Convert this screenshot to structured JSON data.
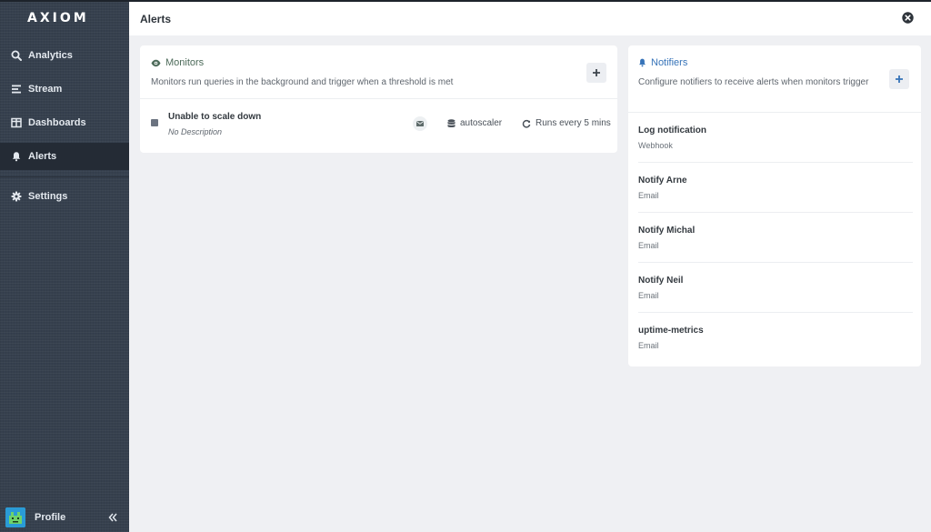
{
  "app": {
    "logo": "AXIOM"
  },
  "sidebar": {
    "items": [
      {
        "label": "Analytics",
        "icon": "search-icon"
      },
      {
        "label": "Stream",
        "icon": "stream-icon"
      },
      {
        "label": "Dashboards",
        "icon": "dashboard-icon"
      },
      {
        "label": "Alerts",
        "icon": "bell-icon",
        "active": true
      },
      {
        "label": "Settings",
        "icon": "gear-icon"
      }
    ],
    "profile_label": "Profile"
  },
  "header": {
    "title": "Alerts"
  },
  "monitors": {
    "title": "Monitors",
    "description": "Monitors run queries in the background and trigger when a threshold is met",
    "items": [
      {
        "name": "Unable to scale down",
        "description": "No Description",
        "dataset": "autoscaler",
        "schedule": "Runs every 5 mins"
      }
    ]
  },
  "notifiers": {
    "title": "Notifiers",
    "description": "Configure notifiers to receive alerts when monitors trigger",
    "items": [
      {
        "name": "Log notification",
        "type": "Webhook"
      },
      {
        "name": "Notify Arne",
        "type": "Email"
      },
      {
        "name": "Notify Michal",
        "type": "Email"
      },
      {
        "name": "Notify Neil",
        "type": "Email"
      },
      {
        "name": "uptime-metrics",
        "type": "Email"
      }
    ]
  },
  "colors": {
    "sidebar_bg": "#36404e",
    "sidebar_active": "#242b35",
    "monitors_accent": "#4d6b5a",
    "notifiers_accent": "#3673b8"
  }
}
